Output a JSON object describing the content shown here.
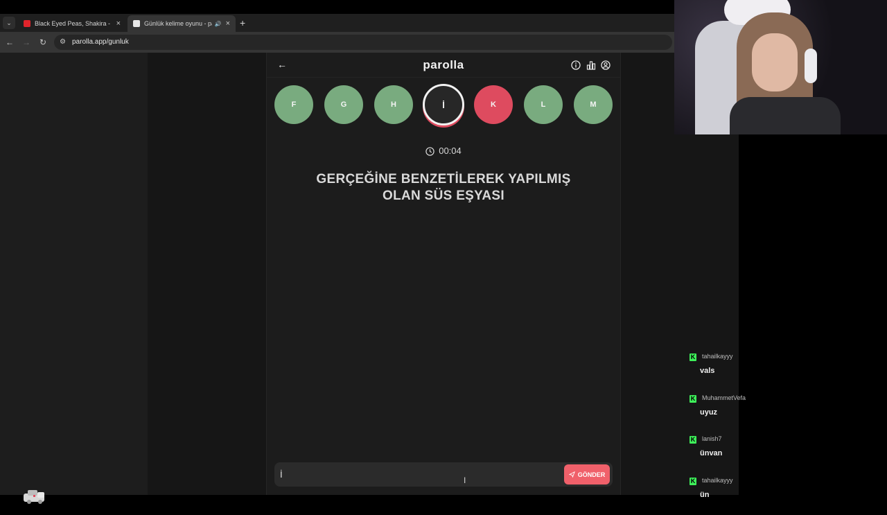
{
  "browser": {
    "tabs": [
      {
        "title": "Black Eyed Peas, Shakira - Girl Like Me",
        "favicon": "youtube-icon",
        "active": false
      },
      {
        "title": "Günlük kelime oyunu - parolla",
        "favicon": "parolla-icon",
        "active": true
      }
    ],
    "url": "parolla.app/gunluk"
  },
  "app": {
    "logo": "parolla",
    "letters": [
      {
        "letter": "F",
        "state": "correct"
      },
      {
        "letter": "G",
        "state": "correct"
      },
      {
        "letter": "H",
        "state": "correct"
      },
      {
        "letter": "İ",
        "state": "active"
      },
      {
        "letter": "K",
        "state": "wrong"
      },
      {
        "letter": "L",
        "state": "correct"
      },
      {
        "letter": "M",
        "state": "correct"
      }
    ],
    "timer": "00:04",
    "question_line1": "GERÇEĞİNE BENZETİLEREK YAPILMIŞ",
    "question_line2": "OLAN SÜS EŞYASI",
    "answer_value": "İ",
    "send_label": "GÖNDER"
  },
  "chat": [
    {
      "user": "tahailkayyy",
      "text": "vals"
    },
    {
      "user": "MuhammetVefa",
      "text": "uyuz"
    },
    {
      "user": "lanish7",
      "text": "ünvan"
    },
    {
      "user": "tahailkayyy",
      "text": "ün"
    }
  ],
  "colors": {
    "correct": "#79ab7f",
    "wrong": "#de4b5f",
    "send": "#f0606a",
    "kick_badge": "#3ef05a"
  }
}
